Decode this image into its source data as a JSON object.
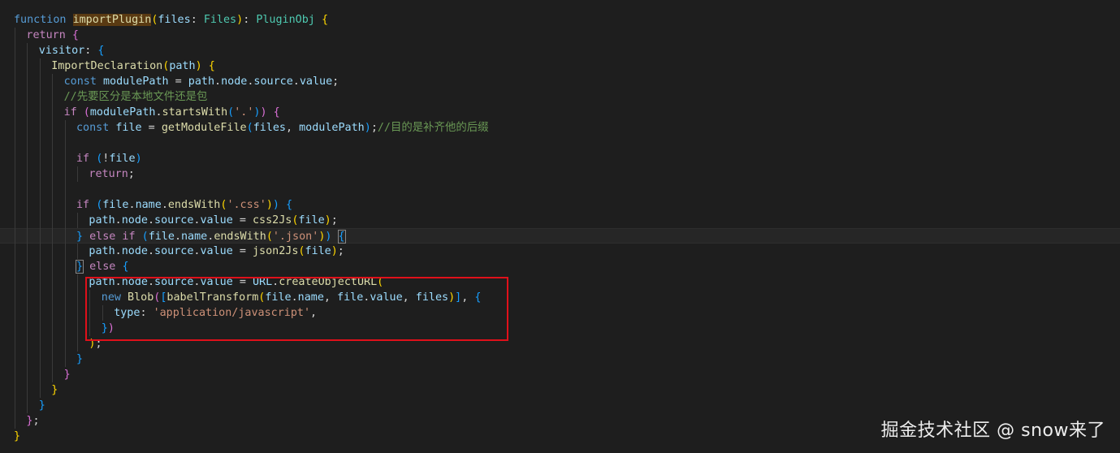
{
  "editor": {
    "theme": "dark",
    "background": "#1e1e1e",
    "lines": [
      {
        "indent": 0,
        "tokens": [
          [
            "k",
            "function "
          ],
          [
            "f hl",
            "importPlugin"
          ],
          [
            "b1",
            "("
          ],
          [
            "v",
            "files"
          ],
          [
            "p",
            ": "
          ],
          [
            "t",
            "Files"
          ],
          [
            "b1",
            ")"
          ],
          [
            "p",
            ": "
          ],
          [
            "t",
            "PluginObj"
          ],
          [
            "p",
            " "
          ],
          [
            "b1",
            "{"
          ]
        ]
      },
      {
        "indent": 1,
        "tokens": [
          [
            "c",
            "return "
          ],
          [
            "b2",
            "{"
          ]
        ]
      },
      {
        "indent": 2,
        "tokens": [
          [
            "v",
            "visitor"
          ],
          [
            "p",
            ": "
          ],
          [
            "b3",
            "{"
          ]
        ]
      },
      {
        "indent": 3,
        "tokens": [
          [
            "f",
            "ImportDeclaration"
          ],
          [
            "b1",
            "("
          ],
          [
            "v",
            "path"
          ],
          [
            "b1",
            ")"
          ],
          [
            "p",
            " "
          ],
          [
            "b1",
            "{"
          ]
        ]
      },
      {
        "indent": 4,
        "tokens": [
          [
            "k",
            "const "
          ],
          [
            "v",
            "modulePath"
          ],
          [
            "p",
            " = "
          ],
          [
            "v",
            "path"
          ],
          [
            "p",
            "."
          ],
          [
            "v",
            "node"
          ],
          [
            "p",
            "."
          ],
          [
            "v",
            "source"
          ],
          [
            "p",
            "."
          ],
          [
            "v",
            "value"
          ],
          [
            "p",
            ";"
          ]
        ]
      },
      {
        "indent": 4,
        "tokens": [
          [
            "cm",
            "//先要区分是本地文件还是包"
          ]
        ]
      },
      {
        "indent": 4,
        "tokens": [
          [
            "c",
            "if "
          ],
          [
            "b2",
            "("
          ],
          [
            "v",
            "modulePath"
          ],
          [
            "p",
            "."
          ],
          [
            "f",
            "startsWith"
          ],
          [
            "b3",
            "("
          ],
          [
            "s",
            "'.'"
          ],
          [
            "b3",
            ")"
          ],
          [
            "b2",
            ")"
          ],
          [
            "p",
            " "
          ],
          [
            "b2",
            "{"
          ]
        ]
      },
      {
        "indent": 5,
        "tokens": [
          [
            "k",
            "const "
          ],
          [
            "v",
            "file"
          ],
          [
            "p",
            " = "
          ],
          [
            "f",
            "getModuleFile"
          ],
          [
            "b3",
            "("
          ],
          [
            "v",
            "files"
          ],
          [
            "p",
            ", "
          ],
          [
            "v",
            "modulePath"
          ],
          [
            "b3",
            ")"
          ],
          [
            "p",
            ";"
          ],
          [
            "cm",
            "//目的是补齐他的后缀"
          ]
        ]
      },
      {
        "indent": 0,
        "tokens": []
      },
      {
        "indent": 5,
        "tokens": [
          [
            "c",
            "if "
          ],
          [
            "b3",
            "("
          ],
          [
            "p",
            "!"
          ],
          [
            "v",
            "file"
          ],
          [
            "b3",
            ")"
          ]
        ]
      },
      {
        "indent": 6,
        "tokens": [
          [
            "c",
            "return"
          ],
          [
            "p",
            ";"
          ]
        ]
      },
      {
        "indent": 0,
        "tokens": []
      },
      {
        "indent": 5,
        "tokens": [
          [
            "c",
            "if "
          ],
          [
            "b3",
            "("
          ],
          [
            "v",
            "file"
          ],
          [
            "p",
            "."
          ],
          [
            "v",
            "name"
          ],
          [
            "p",
            "."
          ],
          [
            "f",
            "endsWith"
          ],
          [
            "b1",
            "("
          ],
          [
            "s",
            "'.css'"
          ],
          [
            "b1",
            ")"
          ],
          [
            "b3",
            ")"
          ],
          [
            "p",
            " "
          ],
          [
            "b3",
            "{"
          ]
        ]
      },
      {
        "indent": 6,
        "tokens": [
          [
            "v",
            "path"
          ],
          [
            "p",
            "."
          ],
          [
            "v",
            "node"
          ],
          [
            "p",
            "."
          ],
          [
            "v",
            "source"
          ],
          [
            "p",
            "."
          ],
          [
            "v",
            "value"
          ],
          [
            "p",
            " = "
          ],
          [
            "f",
            "css2Js"
          ],
          [
            "b1",
            "("
          ],
          [
            "v",
            "file"
          ],
          [
            "b1",
            ")"
          ],
          [
            "p",
            ";"
          ]
        ]
      },
      {
        "indent": 5,
        "tokens": [
          [
            "b3",
            "}"
          ],
          [
            "c",
            " else if "
          ],
          [
            "b3",
            "("
          ],
          [
            "v",
            "file"
          ],
          [
            "p",
            "."
          ],
          [
            "v",
            "name"
          ],
          [
            "p",
            "."
          ],
          [
            "f",
            "endsWith"
          ],
          [
            "b1",
            "("
          ],
          [
            "s",
            "'.json'"
          ],
          [
            "b1",
            ")"
          ],
          [
            "b3",
            ")"
          ],
          [
            "p",
            " "
          ],
          [
            "b3 bm",
            "{"
          ]
        ]
      },
      {
        "indent": 6,
        "tokens": [
          [
            "v",
            "path"
          ],
          [
            "p",
            "."
          ],
          [
            "v",
            "node"
          ],
          [
            "p",
            "."
          ],
          [
            "v",
            "source"
          ],
          [
            "p",
            "."
          ],
          [
            "v",
            "value"
          ],
          [
            "p",
            " = "
          ],
          [
            "f",
            "json2Js"
          ],
          [
            "b1",
            "("
          ],
          [
            "v",
            "file"
          ],
          [
            "b1",
            ")"
          ],
          [
            "p",
            ";"
          ]
        ]
      },
      {
        "indent": 5,
        "tokens": [
          [
            "b3 bm",
            "}"
          ],
          [
            "c",
            " else "
          ],
          [
            "b3",
            "{"
          ]
        ]
      },
      {
        "indent": 6,
        "tokens": [
          [
            "v",
            "path"
          ],
          [
            "p",
            "."
          ],
          [
            "v",
            "node"
          ],
          [
            "p",
            "."
          ],
          [
            "v",
            "source"
          ],
          [
            "p",
            "."
          ],
          [
            "v",
            "value"
          ],
          [
            "p",
            " = "
          ],
          [
            "v",
            "URL"
          ],
          [
            "p",
            "."
          ],
          [
            "f",
            "createObjectURL"
          ],
          [
            "b1",
            "("
          ]
        ]
      },
      {
        "indent": 7,
        "tokens": [
          [
            "k",
            "new "
          ],
          [
            "f",
            "Blob"
          ],
          [
            "b2",
            "("
          ],
          [
            "b3",
            "["
          ],
          [
            "f",
            "babelTransform"
          ],
          [
            "b1",
            "("
          ],
          [
            "v",
            "file"
          ],
          [
            "p",
            "."
          ],
          [
            "v",
            "name"
          ],
          [
            "p",
            ", "
          ],
          [
            "v",
            "file"
          ],
          [
            "p",
            "."
          ],
          [
            "v",
            "value"
          ],
          [
            "p",
            ", "
          ],
          [
            "v",
            "files"
          ],
          [
            "b1",
            ")"
          ],
          [
            "b3",
            "]"
          ],
          [
            "p",
            ", "
          ],
          [
            "b3",
            "{"
          ]
        ]
      },
      {
        "indent": 8,
        "tokens": [
          [
            "v",
            "type"
          ],
          [
            "p",
            ": "
          ],
          [
            "s",
            "'application/javascript'"
          ],
          [
            "p",
            ","
          ]
        ]
      },
      {
        "indent": 7,
        "tokens": [
          [
            "b3",
            "}"
          ],
          [
            "b2",
            ")"
          ]
        ]
      },
      {
        "indent": 6,
        "tokens": [
          [
            "b1",
            ")"
          ],
          [
            "p",
            ";"
          ]
        ]
      },
      {
        "indent": 5,
        "tokens": [
          [
            "b3",
            "}"
          ]
        ]
      },
      {
        "indent": 4,
        "tokens": [
          [
            "b2",
            "}"
          ]
        ]
      },
      {
        "indent": 3,
        "tokens": [
          [
            "b1",
            "}"
          ]
        ]
      },
      {
        "indent": 2,
        "tokens": [
          [
            "b3",
            "}"
          ]
        ]
      },
      {
        "indent": 1,
        "tokens": [
          [
            "b2",
            "}"
          ],
          [
            "p",
            ";"
          ]
        ]
      },
      {
        "indent": 0,
        "tokens": [
          [
            "b1",
            "}"
          ]
        ]
      }
    ],
    "current_line": 14
  },
  "watermark": {
    "text": "掘金技术社区 @ snow来了"
  },
  "colors": {
    "highlight_box": "#e0101a"
  }
}
